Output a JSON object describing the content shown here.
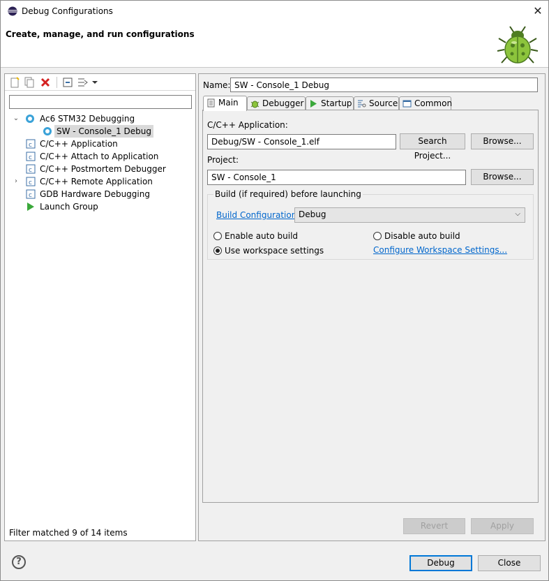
{
  "window": {
    "title": "Debug Configurations",
    "close_glyph": "✕"
  },
  "banner": {
    "heading": "Create, manage, and run configurations"
  },
  "left": {
    "filter_value": "",
    "tree": [
      {
        "label": "Ac6 STM32 Debugging",
        "icon": "stm32-debug-icon",
        "expanded": true
      },
      {
        "label": "SW - Console_1 Debug",
        "icon": "stm32-config-icon",
        "selected": true
      },
      {
        "label": "C/C++ Application",
        "icon": "c-app-icon"
      },
      {
        "label": "C/C++ Attach to Application",
        "icon": "c-app-icon"
      },
      {
        "label": "C/C++ Postmortem Debugger",
        "icon": "c-app-icon"
      },
      {
        "label": "C/C++ Remote Application",
        "icon": "c-app-icon",
        "collapsed": true
      },
      {
        "label": "GDB Hardware Debugging",
        "icon": "c-app-icon"
      },
      {
        "label": "Launch Group",
        "icon": "launch-group-icon"
      }
    ],
    "status": "Filter matched 9 of 14 items"
  },
  "right": {
    "name_label": "Name:",
    "name_value": "SW - Console_1 Debug",
    "tabs": [
      {
        "label": "Main",
        "icon": "main-tab-icon",
        "active": true
      },
      {
        "label": "Debugger",
        "icon": "debugger-tab-icon"
      },
      {
        "label": "Startup",
        "icon": "startup-tab-icon"
      },
      {
        "label": "Source",
        "icon": "source-tab-icon"
      },
      {
        "label": "Common",
        "icon": "common-tab-icon"
      }
    ],
    "app_label": "C/C++ Application:",
    "app_value": "Debug/SW - Console_1.elf",
    "search_project": "Search Project...",
    "browse": "Browse...",
    "project_label": "Project:",
    "project_value": "SW - Console_1",
    "build_group_title": "Build (if required) before launching",
    "build_config_label": "Build Configuration:",
    "build_config_value": "Debug",
    "enable_auto_build": "Enable auto build",
    "disable_auto_build": "Disable auto build",
    "use_workspace": "Use workspace settings",
    "configure_workspace": "Configure Workspace Settings...",
    "revert": "Revert",
    "apply": "Apply"
  },
  "footer": {
    "help": "?",
    "debug": "Debug",
    "close": "Close"
  }
}
